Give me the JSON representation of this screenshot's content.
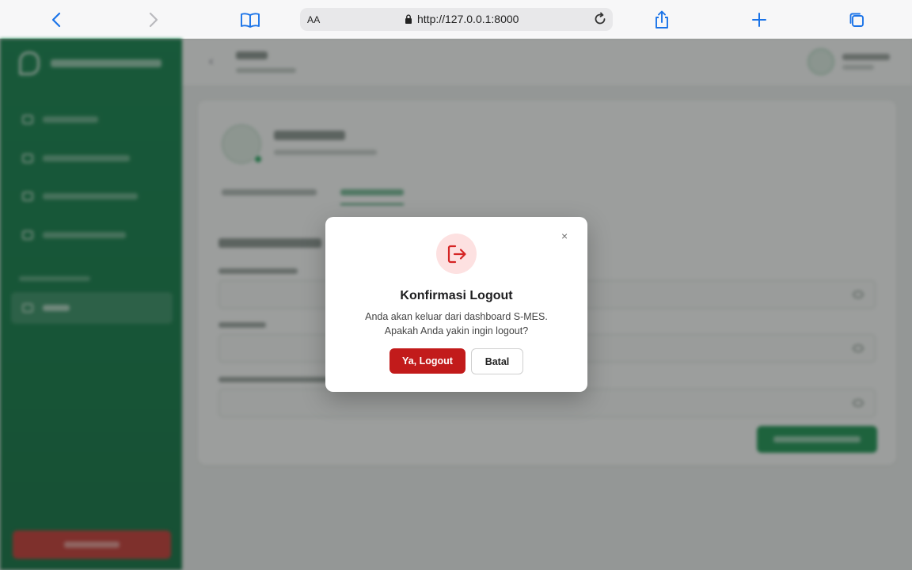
{
  "browser": {
    "reader_label": "AA",
    "url": "http://127.0.0.1:8000",
    "icons": [
      "back-icon",
      "forward-icon",
      "bookmarks-icon",
      "lock-icon",
      "reload-icon",
      "share-icon",
      "new-tab-icon",
      "tabs-icon"
    ],
    "accent": "#1a73e8"
  },
  "modal": {
    "title": "Konfirmasi Logout",
    "message_line1": "Anda akan keluar dari dashboard S-MES.",
    "message_line2": "Apakah Anda yakin ingin logout?",
    "confirm_label": "Ya, Logout",
    "cancel_label": "Batal",
    "close_glyph": "×",
    "icon": "logout-icon",
    "confirm_color": "#c21b1b",
    "icon_bg": "#fde1e1"
  },
  "background": {
    "brand_color": "#0b7a44",
    "danger_color": "#c8342f"
  }
}
